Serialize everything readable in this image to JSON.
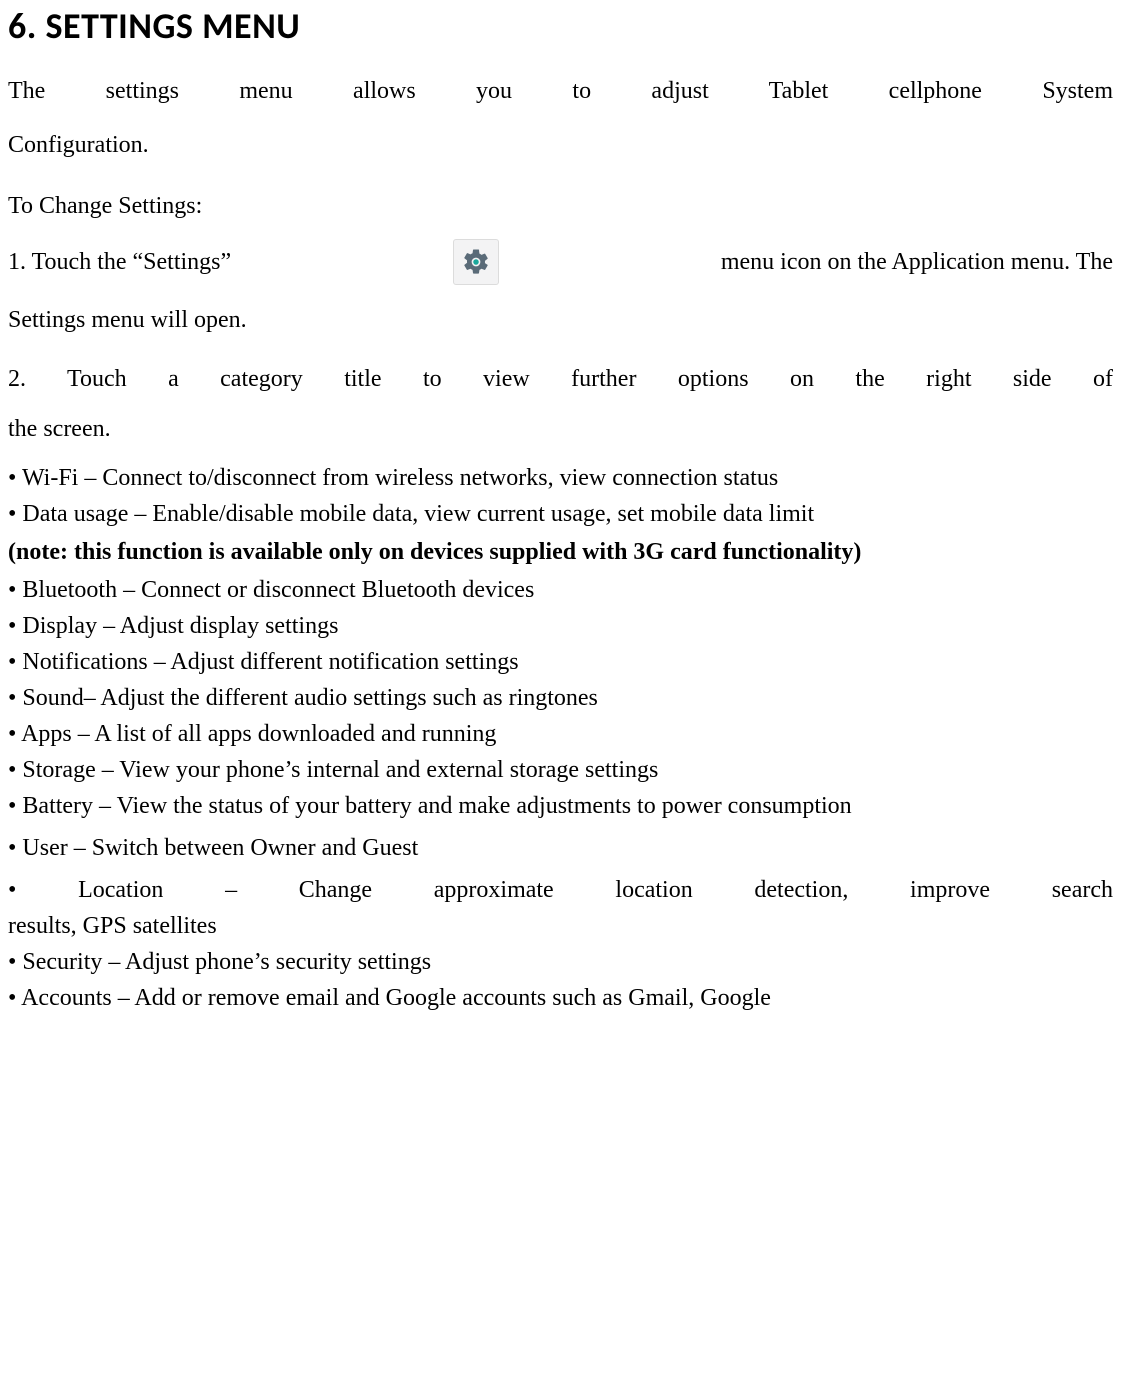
{
  "title": "6. SETTINGS MENU",
  "intro_l1": "The settings menu allows you to adjust Tablet cellphone System",
  "intro_l2": "Configuration.",
  "change_heading": "To Change Settings:",
  "step1_left": "1. Touch the “Settings”",
  "step1_right": "menu icon on the Application menu. The",
  "step1_cont": "Settings menu will open.",
  "step2_l1": "2. Touch a category title to view further options on the right side of",
  "step2_l2": "the screen.",
  "bullets": {
    "wifi": "• Wi-Fi – Connect to/disconnect from wireless networks, view connection status",
    "data": "• Data usage – Enable/disable mobile data, view current usage, set mobile data limit",
    "note": "(note: this function is available only on devices supplied with 3G card functionality)",
    "bt": "• Bluetooth – Connect or disconnect Bluetooth devices",
    "display": "• Display – Adjust display settings",
    "notif": "• Notifications – Adjust different notification settings",
    "sound": "• Sound– Adjust the different audio settings such as ringtones",
    "apps": "• Apps – A list of all apps downloaded and running",
    "storage": "• Storage – View your phone’s internal and external storage settings",
    "battery": "• Battery – View the status of your battery and make adjustments to power consumption",
    "user": "• User – Switch between Owner and Guest",
    "location_l1": "• Location – Change approximate location detection, improve search",
    "location_l2": "results, GPS satellites",
    "security": "• Security – Adjust phone’s security settings",
    "accounts": "• Accounts – Add or remove email and Google accounts such as Gmail, Google"
  }
}
